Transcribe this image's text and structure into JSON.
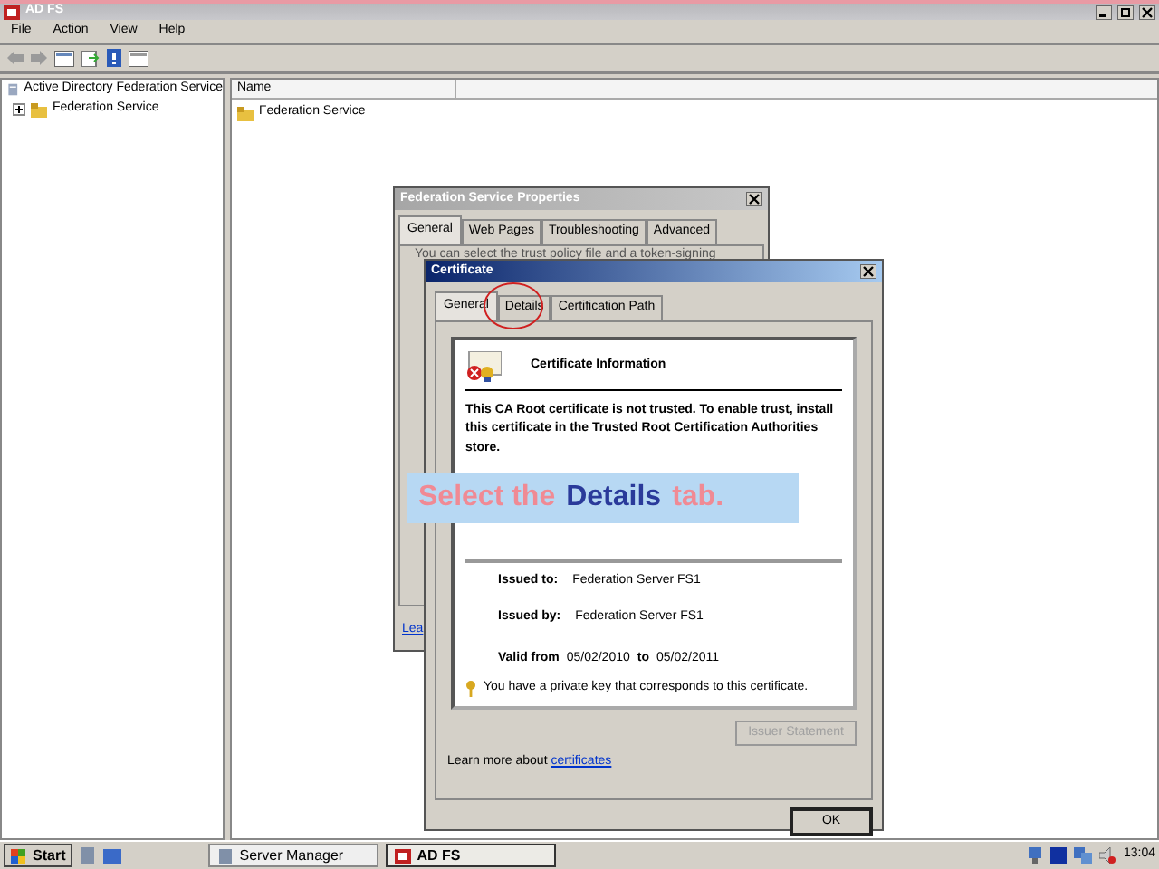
{
  "window": {
    "title": "AD FS"
  },
  "menu": [
    "File",
    "Action",
    "View",
    "Help"
  ],
  "tree": {
    "header": "Active Directory Federation Service",
    "items": [
      {
        "label": "Federation Service",
        "expanded": false
      }
    ]
  },
  "list": {
    "columns": [
      "Name"
    ],
    "rows": [
      "Federation Service"
    ]
  },
  "properties_dialog": {
    "title": "Federation Service Properties",
    "tabs": [
      {
        "label": "General",
        "selected": true
      },
      {
        "label": "Web Pages",
        "selected": false
      },
      {
        "label": "Troubleshooting",
        "selected": false
      },
      {
        "label": "Advanced",
        "selected": false
      }
    ],
    "text": "You can select the trust policy file and a token-signing",
    "link": "Lea"
  },
  "certificate_dialog": {
    "title": "Certificate",
    "tabs": [
      {
        "label": "General",
        "selected": true
      },
      {
        "label": "Details",
        "selected": false
      },
      {
        "label": "Certification Path",
        "selected": false
      }
    ],
    "heading": "Certificate Information",
    "warning": "This CA Root certificate is not trusted. To enable trust, install this certificate in the Trusted Root Certification Authorities store.",
    "fields": [
      {
        "label": "Issued to:",
        "value": "Federation Server FS1"
      },
      {
        "label": "Issued by:",
        "value": "Federation Server FS1"
      }
    ],
    "valid": {
      "label": "Valid from",
      "from": "05/02/2010",
      "to_label": "to",
      "to": "05/02/2011"
    },
    "key_note": "You have a private key that corresponds to this certificate.",
    "issuer_button": {
      "label": "Issuer Statement",
      "disabled": true
    },
    "learn_more": {
      "text": "Learn more about",
      "link": "certificates"
    },
    "ok": "OK"
  },
  "caption": {
    "before": "Select the",
    "highlight": "Details",
    "after": "tab."
  },
  "taskbar": {
    "start": "Start",
    "tasks": [
      {
        "label": "Server Manager",
        "selected": false
      },
      {
        "label": "AD FS",
        "selected": true
      }
    ],
    "clock": "13:04"
  }
}
